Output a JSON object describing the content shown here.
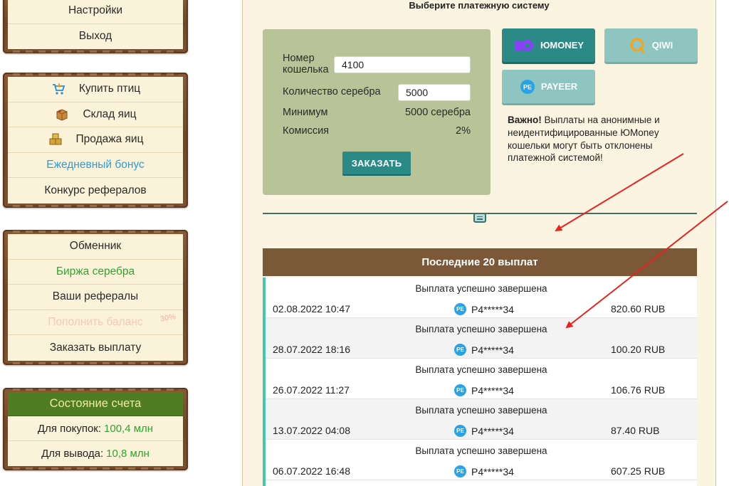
{
  "sidebar": {
    "box1": {
      "items": [
        {
          "label": "Настройки"
        },
        {
          "label": "Выход"
        }
      ]
    },
    "box2": {
      "items": [
        {
          "label": "Купить птиц",
          "icon": "cart-icon"
        },
        {
          "label": "Склад яиц",
          "icon": "egg-box-icon"
        },
        {
          "label": "Продажа яиц",
          "icon": "crates-icon"
        },
        {
          "label": "Ежедневный бонус"
        },
        {
          "label": "Конкурс рефералов"
        }
      ]
    },
    "box3": {
      "items": [
        {
          "label": "Обменник"
        },
        {
          "label": "Биржа серебра"
        },
        {
          "label": "Ваши рефералы"
        },
        {
          "label": "Пополнить баланс"
        },
        {
          "label": "Заказать выплату"
        }
      ],
      "promo_badge": "30%"
    },
    "account": {
      "title": "Состояние счета",
      "buy_label": "Для покупок:",
      "buy_value": "100,4 млн",
      "withdraw_label": "Для вывода:",
      "withdraw_value": "10,8 млн"
    }
  },
  "main": {
    "choose_title": "Выберите платежную систему",
    "form": {
      "wallet_label": "Номер кошелька",
      "wallet_value": "4100",
      "silver_label": "Количество серебра",
      "silver_value": "5000",
      "min_label": "Минимум",
      "min_value": "5000 серебра",
      "fee_label": "Комиссия",
      "fee_value": "2%",
      "order_button": "ЗАКАЗАТЬ"
    },
    "payment_systems": [
      {
        "label": "ЮMONEY",
        "selected": true
      },
      {
        "label": "QIWI",
        "selected": false
      },
      {
        "label": "PAYEER",
        "selected": false
      }
    ],
    "notice": {
      "bold": "Важно!",
      "text": " Выплаты на анонимные и неидентифицированные ЮMoney кошельки могут быть отклонены платежной системой!"
    },
    "payouts": {
      "title": "Последние 20 выплат",
      "rows": [
        {
          "status": "Выплата успешно завершена",
          "date": "02.08.2022 10:47",
          "wallet": "P4*****34",
          "amount": "820.60 RUB"
        },
        {
          "status": "Выплата успешно завершена",
          "date": "28.07.2022 18:16",
          "wallet": "P4*****34",
          "amount": "100.20 RUB"
        },
        {
          "status": "Выплата успешно завершена",
          "date": "26.07.2022 11:27",
          "wallet": "P4*****34",
          "amount": "106.76 RUB"
        },
        {
          "status": "Выплата успешно завершена",
          "date": "13.07.2022 04:08",
          "wallet": "P4*****34",
          "amount": "87.40 RUB"
        },
        {
          "status": "Выплата успешно завершена",
          "date": "06.07.2022 16:48",
          "wallet": "P4*****34",
          "amount": "607.25 RUB"
        }
      ],
      "wallet_icon_text": "PE"
    }
  },
  "colors": {
    "accent_teal": "#2b8a86",
    "wood": "#7b5838",
    "green_value": "#2ea52e",
    "annotation_arrow": "#e8231f"
  }
}
